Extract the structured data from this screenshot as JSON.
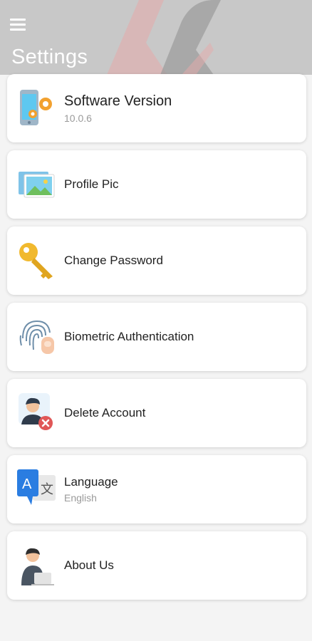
{
  "header": {
    "title": "Settings",
    "menu_icon": "hamburger-menu-icon",
    "background": "#c8c8c8"
  },
  "settings": [
    {
      "key": "software-version",
      "label": "Software Version",
      "sub": "10.0.6",
      "icon": "phone-gear-icon"
    },
    {
      "key": "profile-pic",
      "label": "Profile Pic",
      "sub": "",
      "icon": "photo-icon"
    },
    {
      "key": "change-password",
      "label": "Change Password",
      "sub": "",
      "icon": "key-icon"
    },
    {
      "key": "biometric-authentication",
      "label": "Biometric Authentication",
      "sub": "",
      "icon": "fingerprint-icon"
    },
    {
      "key": "delete-account",
      "label": "Delete Account",
      "sub": "",
      "icon": "user-remove-icon"
    },
    {
      "key": "language",
      "label": "Language",
      "sub": "English",
      "icon": "translate-icon"
    },
    {
      "key": "about-us",
      "label": "About Us",
      "sub": "",
      "icon": "person-laptop-icon"
    }
  ]
}
